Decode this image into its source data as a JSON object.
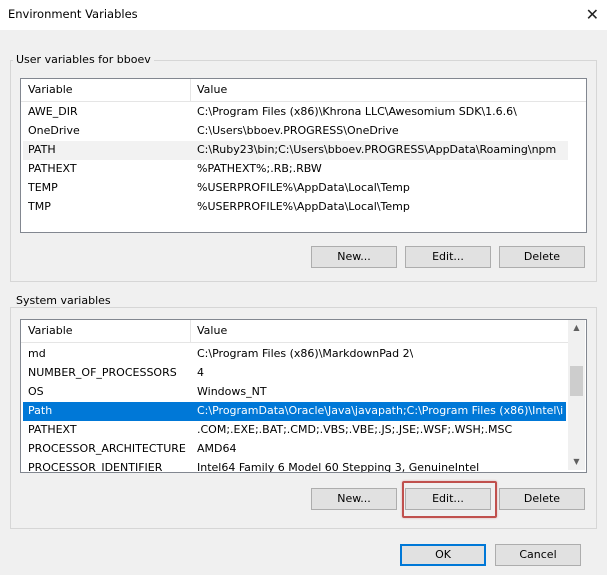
{
  "window": {
    "title": "Environment Variables",
    "close_glyph": "✕"
  },
  "user_section": {
    "label": "User variables for bboev",
    "col_variable": "Variable",
    "col_value": "Value",
    "rows": [
      {
        "variable": "AWE_DIR",
        "value": "C:\\Program Files (x86)\\Khrona LLC\\Awesomium SDK\\1.6.6\\"
      },
      {
        "variable": "OneDrive",
        "value": "C:\\Users\\bboev.PROGRESS\\OneDrive"
      },
      {
        "variable": "PATH",
        "value": "C:\\Ruby23\\bin;C:\\Users\\bboev.PROGRESS\\AppData\\Roaming\\npm"
      },
      {
        "variable": "PATHEXT",
        "value": "%PATHEXT%;.RB;.RBW"
      },
      {
        "variable": "TEMP",
        "value": "%USERPROFILE%\\AppData\\Local\\Temp"
      },
      {
        "variable": "TMP",
        "value": "%USERPROFILE%\\AppData\\Local\\Temp"
      }
    ],
    "buttons": {
      "new": "New...",
      "edit": "Edit...",
      "delete": "Delete"
    }
  },
  "system_section": {
    "label": "System variables",
    "col_variable": "Variable",
    "col_value": "Value",
    "rows": [
      {
        "variable": "md",
        "value": "C:\\Program Files (x86)\\MarkdownPad 2\\"
      },
      {
        "variable": "NUMBER_OF_PROCESSORS",
        "value": "4"
      },
      {
        "variable": "OS",
        "value": "Windows_NT"
      },
      {
        "variable": "Path",
        "value": "C:\\ProgramData\\Oracle\\Java\\javapath;C:\\Program Files (x86)\\Intel\\i..."
      },
      {
        "variable": "PATHEXT",
        "value": ".COM;.EXE;.BAT;.CMD;.VBS;.VBE;.JS;.JSE;.WSF;.WSH;.MSC"
      },
      {
        "variable": "PROCESSOR_ARCHITECTURE",
        "value": "AMD64"
      },
      {
        "variable": "PROCESSOR_IDENTIFIER",
        "value": "Intel64 Family 6 Model 60 Stepping 3, GenuineIntel"
      }
    ],
    "buttons": {
      "new": "New...",
      "edit": "Edit...",
      "delete": "Delete"
    }
  },
  "dialog_buttons": {
    "ok": "OK",
    "cancel": "Cancel"
  },
  "colors": {
    "selection": "#0078d7",
    "highlight_box": "#c0504d"
  }
}
